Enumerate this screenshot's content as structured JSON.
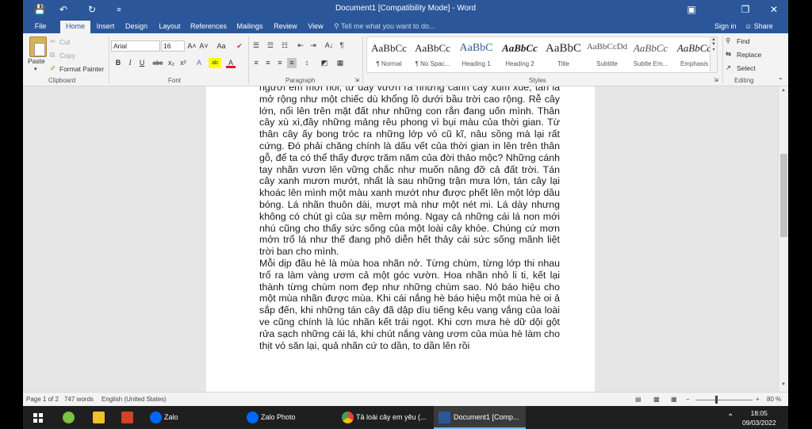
{
  "window": {
    "title": "Document1 [Compatibility Mode] - Word",
    "qat": {
      "save_icon": "💾",
      "undo_icon": "↶",
      "redo_icon": "↻",
      "customize_icon": "≡"
    },
    "controls": {
      "ribbon_display": "▣",
      "restore": "❐",
      "close": "✕"
    }
  },
  "tabs": [
    "File",
    "Home",
    "Insert",
    "Design",
    "Layout",
    "References",
    "Mailings",
    "Review",
    "View"
  ],
  "tell_me": "Tell me what you want to do...",
  "sign_in": "Sign in",
  "share": "Share",
  "clipboard": {
    "paste": "Paste",
    "cut": "Cut",
    "copy": "Copy",
    "format_painter": "Format Painter",
    "label": "Clipboard"
  },
  "font": {
    "name": "Arial",
    "size": "16",
    "grow": "A˄",
    "shrink": "A˅",
    "change_case": "Aa",
    "clear": "✔",
    "bold": "B",
    "italic": "I",
    "underline": "U",
    "strike": "abc",
    "subscript": "x₂",
    "superscript": "x²",
    "effects": "A",
    "highlight": "ab",
    "color": "A",
    "label": "Font"
  },
  "paragraph": {
    "bullets": "☰",
    "numbering": "☲",
    "multilevel": "☷",
    "decrease_indent": "⇤",
    "increase_indent": "⇥",
    "sort": "A↓",
    "show_marks": "¶",
    "align_left": "≡",
    "align_center": "≡",
    "align_right": "≡",
    "justify": "≡",
    "line_spacing": "↕",
    "shading": "◩",
    "borders": "▦",
    "label": "Paragraph"
  },
  "styles": {
    "items": [
      {
        "sample": "AaBbCc",
        "name": "¶ Normal"
      },
      {
        "sample": "AaBbCc",
        "name": "¶ No Spac..."
      },
      {
        "sample": "AaBbC",
        "name": "Heading 1"
      },
      {
        "sample": "AaBbCc",
        "name": "Heading 2"
      },
      {
        "sample": "AaBbC",
        "name": "Title"
      },
      {
        "sample": "AaBbCcDd",
        "name": "Subtitle"
      },
      {
        "sample": "AaBbCc",
        "name": "Subtle Em..."
      },
      {
        "sample": "AaBbCc",
        "name": "Emphasis"
      }
    ],
    "label": "Styles"
  },
  "editing": {
    "find": "Find",
    "replace": "Replace",
    "select": "Select",
    "label": "Editing"
  },
  "document": {
    "paragraphs": [
      "người em mới nói, từ đây vươn ra những cành cây xum xuê, tán lá mở rộng như một chiếc dù khổng lồ dưới bầu trời cao rộng. Rễ cây lớn, nổi lên trên mặt đất như những con rắn đang uốn mình. Thân cây xù xì,đầy những mảng rêu phong vì bụi màu của thời gian. Từ thân cây ấy bong tróc ra những lớp vỏ cũ kĩ, nâu sồng mà lại rất cứng. Đó phải chăng chính là dấu vết của thời gian in lên trên thân gỗ, để ta có thể thấy được trăm năm của đời thảo mộc? Những cánh tay nhãn vươn lên vững chắc như muốn nâng đỡ cả đất trời. Tán cây xanh mươn mướt, nhất là sau những trận mưa lớn, tán cây lại khoác lên mình một màu xanh mướt như được phết lên một lớp dầu bóng. Lá nhãn thuôn dài, mượt mà như một nét mi. Lá dày nhưng không có chút gì của sự mềm mỏng. Ngay cả những cái lá non mới nhú cũng cho thấy sức sống của một loài cây khỏe. Chúng cứ mơn mởn trổ lá như thế đang phô diễn hết thảy cái sức sống mãnh liệt trời ban cho mình.",
      "Mỗi dịp đầu hè là mùa hoa nhãn nở. Từng chùm, từng lớp thi nhau trổ ra làm vàng ươm cả một góc vườn. Hoa nhãn nhỏ li ti, kết lại thành từng chùm nom đẹp như những chùm sao. Nó báo hiệu cho một mùa nhãn được mùa. Khi cái nắng hè báo hiệu một mùa hè oi ả sắp đến, khi những tán cây đã dập dìu tiếng kêu vang vắng của loài ve cũng chính là lúc nhãn kết trái ngọt. Khi cơn mưa hè dữ dội gột rửa sạch những cái lá, khi chút nắng vàng ươm của mùa hè làm cho thịt vỏ săn lại, quả nhãn cứ to dần, to dần lên rồi"
    ]
  },
  "status": {
    "page": "Page 1 of 2",
    "words": "747 words",
    "language": "English (United States)",
    "zoom_minus": "−",
    "zoom_plus": "+",
    "zoom": "80 %"
  },
  "taskbar": {
    "items": [
      {
        "label": "",
        "icon": "windows-start-icon"
      },
      {
        "label": "",
        "icon": "app-green-icon"
      },
      {
        "label": "",
        "icon": "file-explorer-icon"
      },
      {
        "label": "",
        "icon": "powerpoint-icon"
      },
      {
        "label": "Zalo",
        "icon": "zalo-icon"
      },
      {
        "label": "Zalo Photo",
        "icon": "zalo-photo-icon"
      },
      {
        "label": "Tả loài cây em yêu (...",
        "icon": "chrome-icon"
      },
      {
        "label": "Document1 [Comp...",
        "icon": "word-icon"
      }
    ],
    "time": "18:05",
    "date": "09/03/2022"
  },
  "colors": {
    "word_blue": "#2b579a",
    "ribbon_bg": "#f3f3f3",
    "taskbar_bg": "#1f1f1f"
  }
}
